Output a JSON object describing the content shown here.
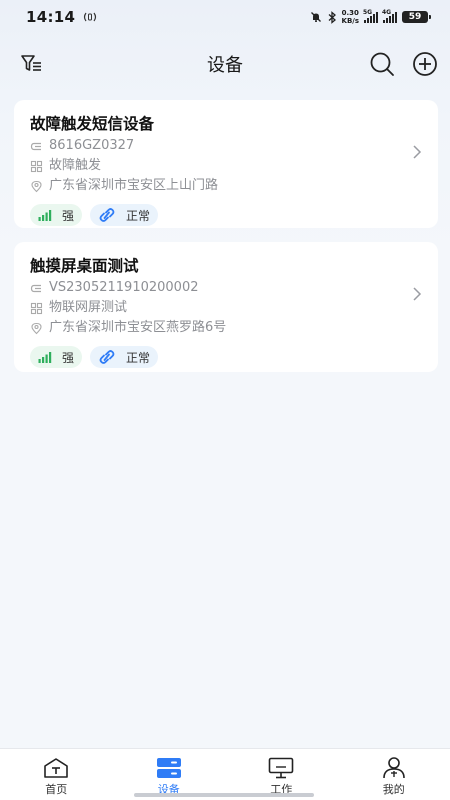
{
  "status_bar": {
    "time": "14:14",
    "net_speed_value": "0.30",
    "net_speed_unit": "KB/s",
    "signal_1_tag": "5G",
    "signal_2_tag": "4G",
    "battery": "59"
  },
  "header": {
    "title": "设备",
    "icons": [
      "filter-icon",
      "search-icon",
      "add-icon"
    ]
  },
  "devices": [
    {
      "name": "故障触发短信设备",
      "serial": "8616GZ0327",
      "group": "故障触发",
      "address": "广东省深圳市宝安区上山门路",
      "signal_label": "强",
      "status_label": "正常"
    },
    {
      "name": "触摸屏桌面测试",
      "serial": "VS2305211910200002",
      "group": "物联网屏测试",
      "address": "广东省深圳市宝安区燕罗路6号",
      "signal_label": "强",
      "status_label": "正常"
    }
  ],
  "bottom_nav": {
    "items": [
      {
        "label": "首页",
        "icon": "home-icon"
      },
      {
        "label": "设备",
        "icon": "device-icon"
      },
      {
        "label": "工作",
        "icon": "monitor-icon"
      },
      {
        "label": "我的",
        "icon": "profile-icon"
      }
    ],
    "active_index": 1
  },
  "colors": {
    "accent": "#2f7cf6",
    "signal_green": "#2eaf5c",
    "status_blue": "#2f7cf6",
    "muted_text": "#8d8f94"
  }
}
